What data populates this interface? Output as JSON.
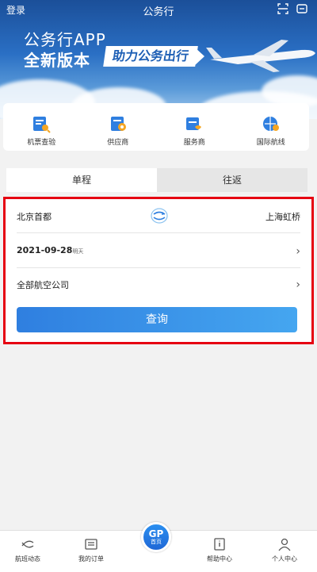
{
  "header": {
    "login": "登录",
    "title": "公务行"
  },
  "banner": {
    "line1": "公务行APP",
    "line2": "全新版本",
    "tag": "助力公务出行"
  },
  "shortcuts": [
    {
      "label": "机票查验",
      "icon": "ticket-check-icon"
    },
    {
      "label": "供应商",
      "icon": "supplier-icon"
    },
    {
      "label": "服务商",
      "icon": "service-provider-icon"
    },
    {
      "label": "国际航线",
      "icon": "international-route-icon"
    }
  ],
  "tabs": {
    "one_way": "单程",
    "round_trip": "往返"
  },
  "search": {
    "from": "北京首都",
    "to": "上海虹桥",
    "date": "2021-09-28",
    "date_note": "明天",
    "airline": "全部航空公司",
    "query_button": "查询"
  },
  "bottom_nav": [
    {
      "label": "航班动态",
      "icon": "flight-status-icon"
    },
    {
      "label": "我的订单",
      "icon": "orders-icon"
    },
    {
      "label": "首页",
      "icon": "home-icon",
      "logo": "GP"
    },
    {
      "label": "帮助中心",
      "icon": "help-icon"
    },
    {
      "label": "个人中心",
      "icon": "user-icon"
    }
  ],
  "colors": {
    "accent": "#2f7fe0",
    "highlight_border": "#e60012",
    "banner": "#2a6fc4"
  }
}
